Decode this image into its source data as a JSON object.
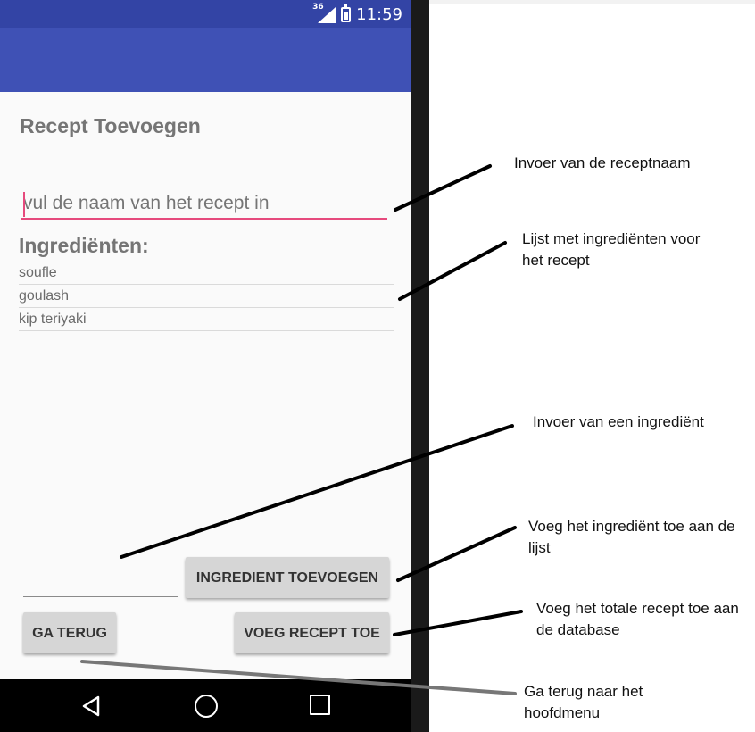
{
  "status_bar": {
    "network": "36",
    "time": "11:59"
  },
  "screen": {
    "title": "Recept Toevoegen",
    "name_input_placeholder": "vul de naam van het recept in",
    "ingredients_label": "Ingrediënten:",
    "ingredients": [
      "soufle",
      "goulash",
      "kip teriyaki"
    ],
    "ingredient_input_value": "",
    "add_ingredient_button": "INGREDIENT TOEVOEGEN",
    "back_button": "GA TERUG",
    "add_recipe_button": "VOEG RECEPT TOE"
  },
  "annotations": {
    "name_input": "Invoer van de receptnaam",
    "ingredient_list": "Lijst met ingrediënten voor het recept",
    "ingredient_input": "Invoer van een ingrediënt",
    "add_ingredient": "Voeg het ingrediënt toe aan de lijst",
    "add_recipe": "Voeg het totale recept toe aan de database",
    "back": "Ga terug naar het hoofdmenu"
  },
  "colors": {
    "primary": "#3f51b5",
    "primary_dark": "#3344a5",
    "accent": "#e64a7d",
    "button": "#d6d6d6"
  }
}
